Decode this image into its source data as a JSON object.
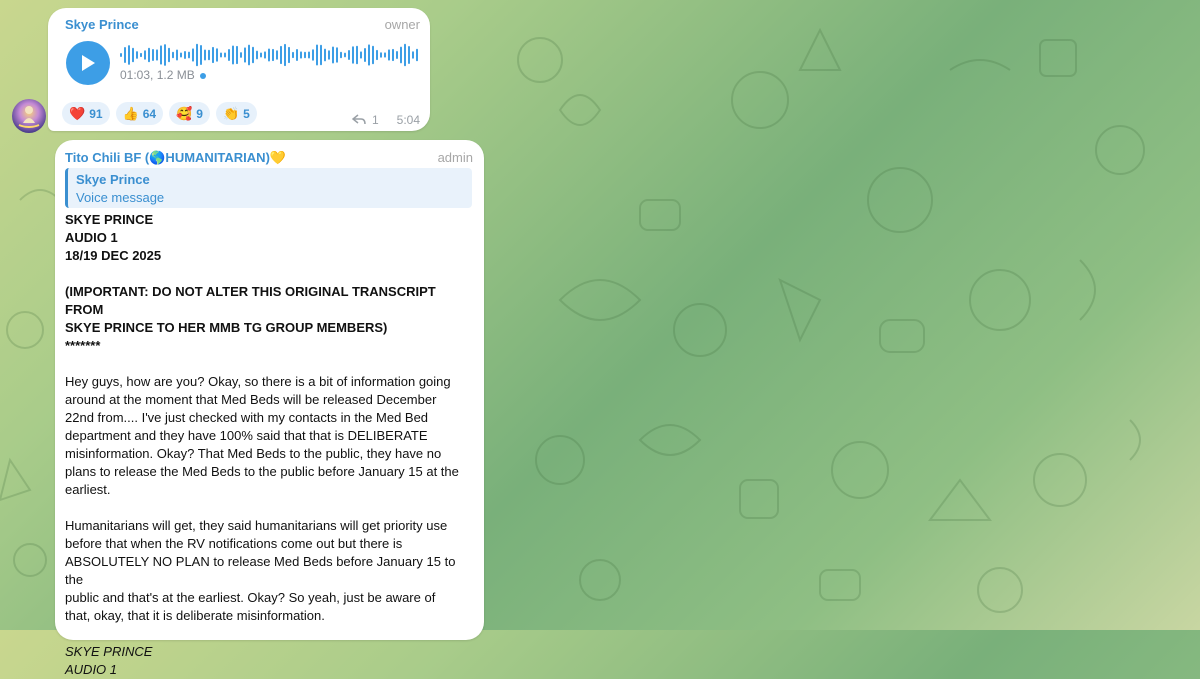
{
  "voice_post": {
    "sender": "Skye Prince",
    "role": "owner",
    "duration_size": "01:03, 1.2 MB",
    "reactions": [
      {
        "emoji": "❤️",
        "count": "91"
      },
      {
        "emoji": "👍",
        "count": "64"
      },
      {
        "emoji": "🥰",
        "count": "9"
      },
      {
        "emoji": "👏",
        "count": "5"
      }
    ],
    "replies": "1",
    "time": "5:04"
  },
  "reply_post": {
    "sender": "Tito Chili BF (🌎HUMANITARIAN)💛",
    "role": "admin",
    "quote_name": "Skye Prince",
    "quote_text": "Voice message",
    "header_lines": [
      "SKYE PRINCE",
      "AUDIO 1",
      "18/19 DEC 2025"
    ],
    "important_line1": "(IMPORTANT: DO NOT ALTER THIS ORIGINAL TRANSCRIPT FROM",
    "important_line2": "SKYE PRINCE TO HER MMB TG GROUP MEMBERS)",
    "stars": "*******",
    "para1": [
      "Hey guys, how are you? Okay, so there is a bit of information going",
      "around at the moment that Med Beds will be released December",
      "22nd from.... I've just checked with my contacts in the Med Bed",
      "department and they have 100% said that that is DELIBERATE",
      "misinformation.  Okay?  That Med Beds to the public, they have no",
      "plans to release the Med Beds to the public before January 15 at the",
      "earliest."
    ],
    "para2": [
      "Humanitarians will get, they said humanitarians will get priority use",
      "before that when the RV notifications come out but there is",
      "ABSOLUTELY NO PLAN to release Med Beds before January 15 to the",
      "public and that's at the earliest.  Okay?  So yeah, just be aware of",
      "that, okay, that it is deliberate misinformation."
    ],
    "signature": "SKYE PRINCE",
    "signature_cut": "AUDIO 1"
  },
  "colors": {
    "accent": "#3a8fd0",
    "play_button": "#3d9ee6",
    "bubble": "#ffffff",
    "quote_bg": "#e9f2fb"
  }
}
